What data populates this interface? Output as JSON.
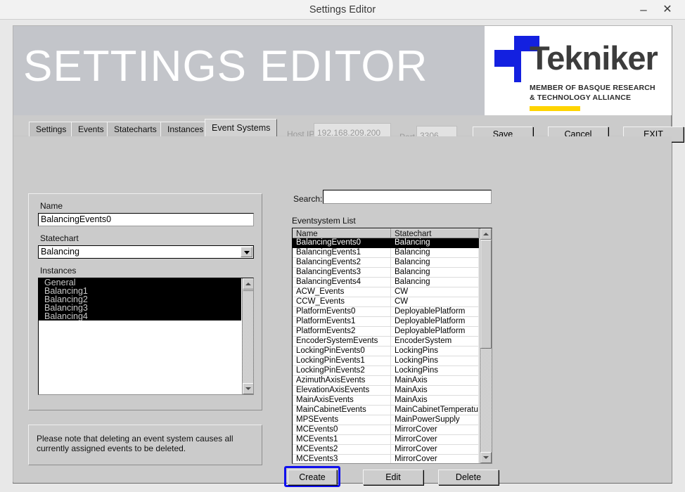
{
  "window": {
    "title": "Settings Editor",
    "minimize_label": "–",
    "close_label": "✕"
  },
  "banner": {
    "title": "SETTINGS EDITOR",
    "logo_word": "Tekniker",
    "logo_sub_line1": "MEMBER OF BASQUE RESEARCH",
    "logo_sub_line2": "& TECHNOLOGY ALLIANCE",
    "logo_blue": "#1320e0",
    "logo_yellow": "#ffd400"
  },
  "tabs": [
    {
      "label": "Settings",
      "active": false
    },
    {
      "label": "Events",
      "active": false
    },
    {
      "label": "Statecharts",
      "active": false
    },
    {
      "label": "Instances",
      "active": false
    },
    {
      "label": "Event Systems",
      "active": true
    }
  ],
  "connection": {
    "host_ip_label": "Host IP",
    "host_ip_value": "192.168.209.200",
    "port_label": "Port",
    "port_value": "3306"
  },
  "top_buttons": {
    "save": "Save",
    "cancel": "Cancel",
    "exit": "EXIT"
  },
  "editor": {
    "name_label": "Name",
    "name_value": "BalancingEvents0",
    "statechart_label": "Statechart",
    "statechart_value": "Balancing",
    "instances_label": "Instances",
    "instances": [
      {
        "label": "General",
        "selected": true
      },
      {
        "label": "Balancing1",
        "selected": true
      },
      {
        "label": "Balancing2",
        "selected": true
      },
      {
        "label": "Balancing3",
        "selected": true
      },
      {
        "label": "Balancing4",
        "selected": true
      }
    ],
    "note": "Please note that deleting an event system causes all currently assigned events to be deleted."
  },
  "search": {
    "label": "Search:",
    "value": "",
    "placeholder": ""
  },
  "eventsystem_list": {
    "label": "Eventsystem List",
    "columns": [
      "Name",
      "Statechart"
    ],
    "rows": [
      {
        "name": "BalancingEvents0",
        "statechart": "Balancing",
        "selected": true
      },
      {
        "name": "BalancingEvents1",
        "statechart": "Balancing",
        "selected": false
      },
      {
        "name": "BalancingEvents2",
        "statechart": "Balancing",
        "selected": false
      },
      {
        "name": "BalancingEvents3",
        "statechart": "Balancing",
        "selected": false
      },
      {
        "name": "BalancingEvents4",
        "statechart": "Balancing",
        "selected": false
      },
      {
        "name": "ACW_Events",
        "statechart": "CW",
        "selected": false
      },
      {
        "name": "CCW_Events",
        "statechart": "CW",
        "selected": false
      },
      {
        "name": "PlatformEvents0",
        "statechart": "DeployablePlatform",
        "selected": false
      },
      {
        "name": "PlatformEvents1",
        "statechart": "DeployablePlatform",
        "selected": false
      },
      {
        "name": "PlatformEvents2",
        "statechart": "DeployablePlatform",
        "selected": false
      },
      {
        "name": "EncoderSystemEvents",
        "statechart": "EncoderSystem",
        "selected": false
      },
      {
        "name": "LockingPinEvents0",
        "statechart": "LockingPins",
        "selected": false
      },
      {
        "name": "LockingPinEvents1",
        "statechart": "LockingPins",
        "selected": false
      },
      {
        "name": "LockingPinEvents2",
        "statechart": "LockingPins",
        "selected": false
      },
      {
        "name": "AzimuthAxisEvents",
        "statechart": "MainAxis",
        "selected": false
      },
      {
        "name": "ElevationAxisEvents",
        "statechart": "MainAxis",
        "selected": false
      },
      {
        "name": "MainAxisEvents",
        "statechart": "MainAxis",
        "selected": false
      },
      {
        "name": "MainCabinetEvents",
        "statechart": "MainCabinetTemperature",
        "selected": false
      },
      {
        "name": "MPSEvents",
        "statechart": "MainPowerSupply",
        "selected": false
      },
      {
        "name": "MCEvents0",
        "statechart": "MirrorCover",
        "selected": false
      },
      {
        "name": "MCEvents1",
        "statechart": "MirrorCover",
        "selected": false
      },
      {
        "name": "MCEvents2",
        "statechart": "MirrorCover",
        "selected": false
      },
      {
        "name": "MCEvents3",
        "statechart": "MirrorCover",
        "selected": false
      }
    ]
  },
  "bottom_buttons": {
    "create": "Create",
    "edit": "Edit",
    "delete": "Delete",
    "focus_color": "#1010ee"
  }
}
